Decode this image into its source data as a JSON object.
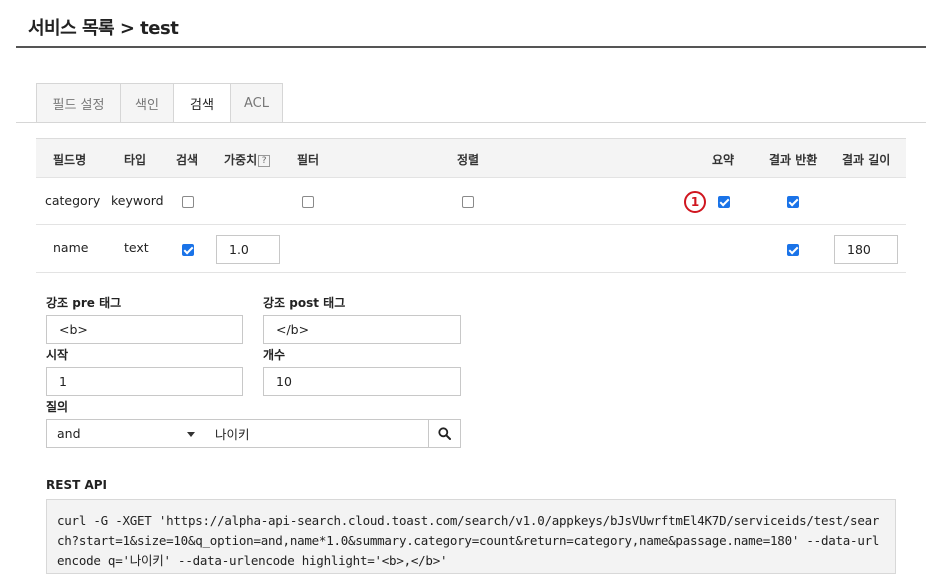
{
  "page": {
    "title": "서비스 목록 > test"
  },
  "tabs": [
    {
      "label": "필드 설정",
      "active": false
    },
    {
      "label": "색인",
      "active": false
    },
    {
      "label": "검색",
      "active": true
    },
    {
      "label": "ACL",
      "active": false
    }
  ],
  "grid": {
    "headers": {
      "field_name": "필드명",
      "type": "타입",
      "search": "검색",
      "weight": "가중치",
      "weight_help": "?",
      "filter": "필터",
      "sort": "정렬",
      "summary": "요약",
      "return": "결과 반환",
      "length": "결과 길이"
    },
    "rows": [
      {
        "field_name": "category",
        "type": "keyword",
        "search": false,
        "filter": false,
        "sort": false,
        "summary_badge": "1",
        "summary": true,
        "return": true
      },
      {
        "field_name": "name",
        "type": "text",
        "search": true,
        "weight": "1.0",
        "return": true,
        "length": "180"
      }
    ]
  },
  "form": {
    "highlight_pre": {
      "label": "강조 pre 태그",
      "value": "<b>"
    },
    "highlight_post": {
      "label": "강조 post 태그",
      "value": "</b>"
    },
    "start": {
      "label": "시작",
      "value": "1"
    },
    "size": {
      "label": "개수",
      "value": "10"
    },
    "query": {
      "label": "질의",
      "option": "and",
      "value": "나이키"
    }
  },
  "rest_api": {
    "label": "REST API",
    "command": "curl -G -XGET 'https://alpha-api-search.cloud.toast.com/search/v1.0/appkeys/bJsVUwrftmEl4K7D/serviceids/test/search?start=1&size=10&q_option=and,name*1.0&summary.category=count&return=category,name&passage.name=180' --data-urlencode q='나이키' --data-urlencode highlight='<b>,</b>'"
  },
  "icons": {
    "search": "search-icon",
    "dropdown": "chevron-down-icon"
  },
  "colors": {
    "accent": "#1a73e8",
    "badge": "#d0161f"
  }
}
